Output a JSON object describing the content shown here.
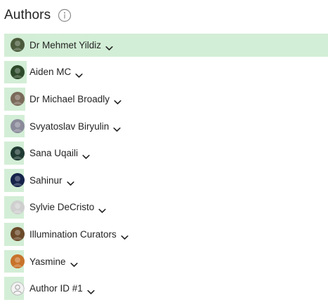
{
  "header": {
    "title": "Authors",
    "info_icon": "info-icon"
  },
  "colors": {
    "bar_fill": "#d3eed6",
    "text": "#242424"
  },
  "authors": [
    {
      "name": "Dr Mehmet Yildiz",
      "value": 1.0,
      "avatar": "avatar-photo",
      "avatar_color": "#4a5a3a"
    },
    {
      "name": "Aiden MC",
      "value": 0.07,
      "avatar": "avatar-photo",
      "avatar_color": "#2d4a2b"
    },
    {
      "name": "Dr Michael Broadly",
      "value": 0.066,
      "avatar": "avatar-photo",
      "avatar_color": "#7a6a5a"
    },
    {
      "name": "Svyatoslav Biryulin",
      "value": 0.062,
      "avatar": "avatar-photo",
      "avatar_color": "#8a8a9a"
    },
    {
      "name": "Sana Uqaili",
      "value": 0.06,
      "avatar": "avatar-photo",
      "avatar_color": "#1f3a33"
    },
    {
      "name": "Sahinur",
      "value": 0.058,
      "avatar": "avatar-photo",
      "avatar_color": "#15234a"
    },
    {
      "name": "Sylvie DeCristo",
      "value": 0.05,
      "avatar": "avatar-photo",
      "avatar_color": "#cfcfcf"
    },
    {
      "name": "Illumination Curators",
      "value": 0.045,
      "avatar": "avatar-photo",
      "avatar_color": "#6b4a2a"
    },
    {
      "name": "Yasmine",
      "value": 0.04,
      "avatar": "avatar-photo",
      "avatar_color": "#c8732a"
    },
    {
      "name": "Author ID #1",
      "value": 0.03,
      "avatar": "avatar-placeholder",
      "avatar_color": "#bdbdbd"
    }
  ]
}
